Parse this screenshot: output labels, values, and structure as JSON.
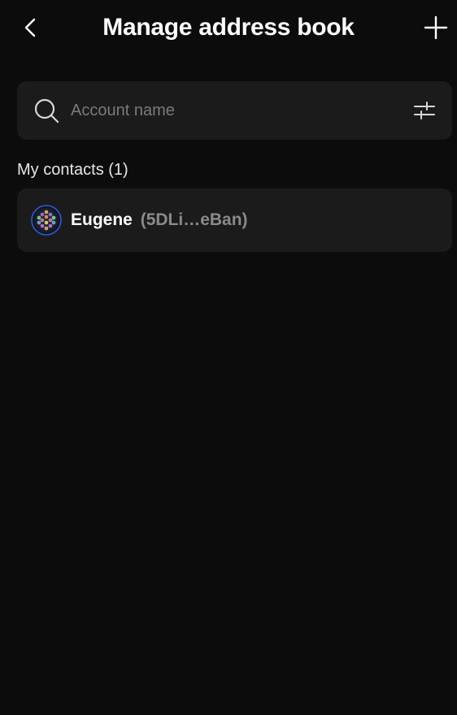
{
  "header": {
    "title": "Manage address book",
    "back_icon": "chevron-left-icon",
    "add_icon": "plus-icon"
  },
  "search": {
    "placeholder": "Account name",
    "value": "",
    "search_icon": "search-icon",
    "filter_icon": "filter-sliders-icon"
  },
  "contacts": {
    "section_label": "My contacts (1)",
    "items": [
      {
        "name": "Eugene",
        "address": "(5DLi…eBan)",
        "avatar_icon": "identicon-avatar"
      }
    ]
  },
  "colors": {
    "background": "#0c0c0c",
    "surface": "#1b1b1b",
    "text_primary": "#ffffff",
    "text_muted": "#8a8a8a",
    "placeholder": "#7a7a7a",
    "avatar_ring": "#2f5bd8"
  }
}
